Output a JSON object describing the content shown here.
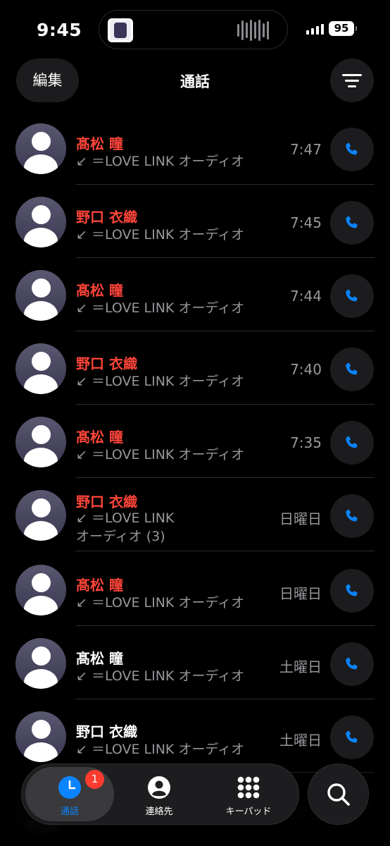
{
  "status_bar": {
    "time": "9:45",
    "battery_level": "95"
  },
  "nav": {
    "edit_label": "編集",
    "title": "通話",
    "filter_icon": "filter-lines-icon"
  },
  "calls": [
    {
      "name": "髙松 瞳",
      "missed": true,
      "detail": "↙ ＝LOVE LINK オーディオ",
      "time": "7:47"
    },
    {
      "name": "野口 衣織",
      "missed": true,
      "detail": "↙ ＝LOVE LINK オーディオ",
      "time": "7:45"
    },
    {
      "name": "髙松 瞳",
      "missed": true,
      "detail": "↙ ＝LOVE LINK オーディオ",
      "time": "7:44"
    },
    {
      "name": "野口 衣織",
      "missed": true,
      "detail": "↙ ＝LOVE LINK オーディオ",
      "time": "7:40"
    },
    {
      "name": "髙松 瞳",
      "missed": true,
      "detail": "↙ ＝LOVE LINK オーディオ",
      "time": "7:35"
    },
    {
      "name": "野口 衣織",
      "missed": true,
      "detail": "↙ ＝LOVE LINK オーディオ (3)",
      "time": "日曜日"
    },
    {
      "name": "髙松 瞳",
      "missed": true,
      "detail": "↙ ＝LOVE LINK オーディオ",
      "time": "日曜日"
    },
    {
      "name": "髙松 瞳",
      "missed": false,
      "detail": "↙ ＝LOVE LINK オーディオ",
      "time": "土曜日"
    },
    {
      "name": "野口 衣織",
      "missed": false,
      "detail": "↙ ＝LOVE LINK オーディオ",
      "time": "土曜日"
    },
    {
      "name": "",
      "missed": false,
      "detail": "",
      "time": "土曜日"
    }
  ],
  "tabs": {
    "recents_label": "通話",
    "recents_badge": "1",
    "contacts_label": "連絡先",
    "keypad_label": "キーパッド"
  },
  "colors": {
    "missed": "#ff453a",
    "accent": "#0a84ff",
    "secondary_text": "#98989d"
  }
}
